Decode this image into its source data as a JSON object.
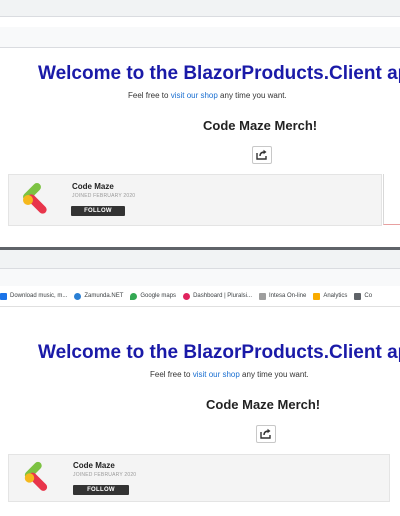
{
  "bookmarks": [
    {
      "label": "Download music, m...",
      "icon": "download-icon",
      "color": "#1a73e8"
    },
    {
      "label": "Zamunda.NET",
      "icon": "zamunda-icon",
      "color": "#2a7fd4"
    },
    {
      "label": "Google maps",
      "icon": "map-pin-icon",
      "color": "#34a853"
    },
    {
      "label": "Dashboard | Pluralsi...",
      "icon": "pluralsight-icon",
      "color": "#e0245e"
    },
    {
      "label": "Intesa On-line",
      "icon": "bank-icon",
      "color": "#9e9e9e"
    },
    {
      "label": "Analytics",
      "icon": "analytics-icon",
      "color": "#f9ab00"
    },
    {
      "label": "Co",
      "icon": "doc-icon",
      "color": "#5f6368"
    }
  ],
  "page": {
    "welcome": "Welcome to the BlazorProducts.Client ap",
    "subtitle_pre": "Feel free to ",
    "subtitle_link": "visit our shop",
    "subtitle_post": " any time you want.",
    "merch_title": "Code Maze Merch!"
  },
  "profile": {
    "name": "Code Maze",
    "joined": "JOINED FEBRUARY 2020",
    "follow": "FOLLOW"
  },
  "colors": {
    "heading": "#1a1aa8",
    "link": "#1a6fd1",
    "logo_green": "#7cc242",
    "logo_red": "#e8354b",
    "logo_yellow": "#f5b81c"
  }
}
